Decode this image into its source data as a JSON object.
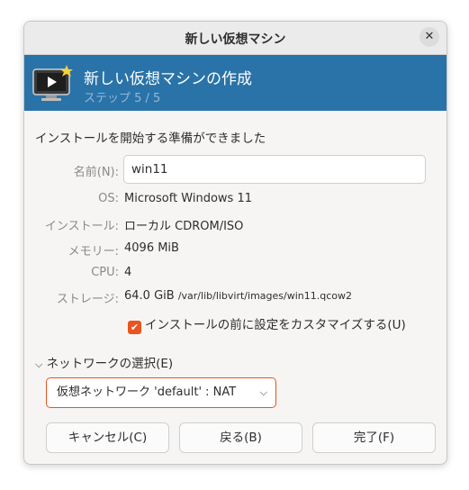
{
  "window": {
    "title": "新しい仮想マシン",
    "close_label": "✕"
  },
  "banner": {
    "title": "新しい仮想マシンの作成",
    "step": "ステップ 5 / 5",
    "icon": "vm-monitor-icon"
  },
  "heading": "インストールを開始する準備ができました",
  "form": {
    "name_label": "名前(N):",
    "name_value": "win11",
    "os_label": "OS:",
    "os_value": "Microsoft Windows 11",
    "install_label": "インストール:",
    "install_value": "ローカル CDROM/ISO",
    "memory_label": "メモリー:",
    "memory_value": "4096 MiB",
    "cpu_label": "CPU:",
    "cpu_value": "4",
    "storage_label": "ストレージ:",
    "storage_size": "64.0 GiB",
    "storage_path": "/var/lib/libvirt/images/win11.qcow2"
  },
  "customize": {
    "label": "インストールの前に設定をカスタマイズする(U)",
    "checked": true
  },
  "network": {
    "expander_label": "ネットワークの選択(E)",
    "selected": "仮想ネットワーク 'default' : NAT"
  },
  "buttons": {
    "cancel": "キャンセル(C)",
    "back": "戻る(B)",
    "finish": "完了(F)"
  },
  "colors": {
    "accent": "#e95420",
    "banner": "#2a73a8"
  }
}
